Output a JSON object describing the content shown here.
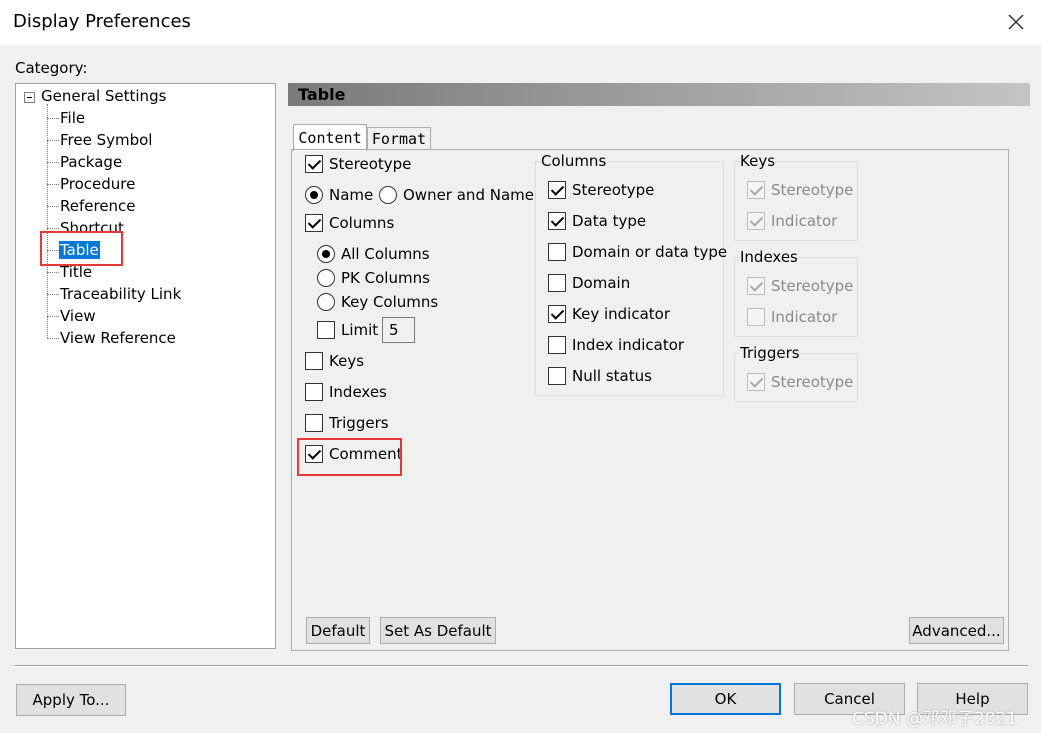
{
  "window": {
    "title": "Display Preferences",
    "close_icon": "close-icon"
  },
  "category": {
    "label": "Category:",
    "tree": {
      "root": "General Settings",
      "items": [
        "File",
        "Free Symbol",
        "Package",
        "Procedure",
        "Reference",
        "Shortcut",
        "Table",
        "Title",
        "Traceability Link",
        "View",
        "View Reference"
      ],
      "selected": "Table"
    }
  },
  "header": {
    "title": "Table"
  },
  "tabs": [
    {
      "label": "Content",
      "active": true
    },
    {
      "label": "Format",
      "active": false
    }
  ],
  "content": {
    "stereotype": {
      "label": "Stereotype",
      "checked": true
    },
    "name_radio": {
      "label": "Name",
      "selected": true
    },
    "owner_radio": {
      "label": "Owner and Name",
      "selected": false
    },
    "columns": {
      "label": "Columns",
      "checked": true
    },
    "all_columns": {
      "label": "All Columns",
      "selected": true
    },
    "pk_columns": {
      "label": "PK Columns",
      "selected": false
    },
    "key_columns": {
      "label": "Key Columns",
      "selected": false
    },
    "limit": {
      "label": "Limit",
      "checked": false,
      "value": "5"
    },
    "keys": {
      "label": "Keys",
      "checked": false
    },
    "indexes": {
      "label": "Indexes",
      "checked": false
    },
    "triggers": {
      "label": "Triggers",
      "checked": false
    },
    "comment": {
      "label": "Comment",
      "checked": true
    }
  },
  "columns_group": {
    "title": "Columns",
    "items": [
      {
        "label": "Stereotype",
        "checked": true
      },
      {
        "label": "Data type",
        "checked": true
      },
      {
        "label": "Domain or data type",
        "checked": false
      },
      {
        "label": "Domain",
        "checked": false
      },
      {
        "label": "Key indicator",
        "checked": true
      },
      {
        "label": "Index indicator",
        "checked": false
      },
      {
        "label": "Null status",
        "checked": false
      }
    ]
  },
  "keys_group": {
    "title": "Keys",
    "items": [
      {
        "label": "Stereotype",
        "checked": true
      },
      {
        "label": "Indicator",
        "checked": true
      }
    ]
  },
  "indexes_group": {
    "title": "Indexes",
    "items": [
      {
        "label": "Stereotype",
        "checked": true
      },
      {
        "label": "Indicator",
        "checked": false
      }
    ]
  },
  "triggers_group": {
    "title": "Triggers",
    "items": [
      {
        "label": "Stereotype",
        "checked": true
      }
    ]
  },
  "buttons": {
    "default": "Default",
    "set_as_default": "Set As Default",
    "advanced": "Advanced...",
    "apply_to": "Apply To...",
    "ok": "OK",
    "cancel": "Cancel",
    "help": "Help"
  },
  "watermark": "CSDN @邓邓子2021",
  "colors": {
    "selection": "#0078d7",
    "highlight_box": "#e53935",
    "header_gradient_start": "#7a7a7a"
  }
}
